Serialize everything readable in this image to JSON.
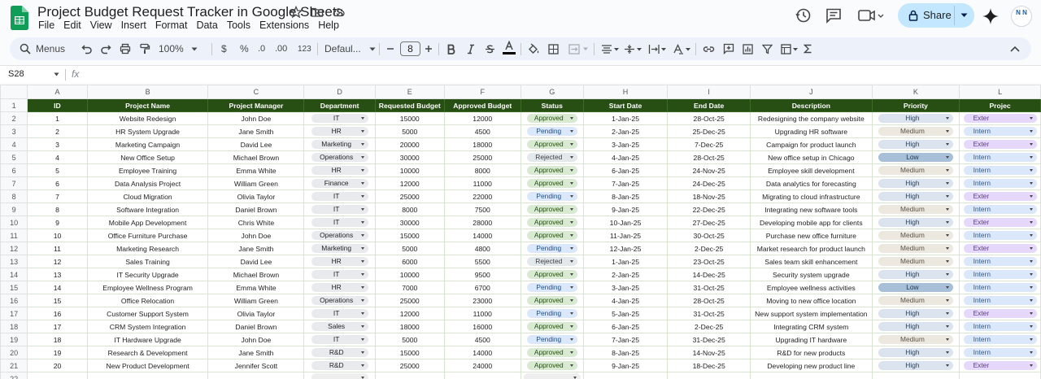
{
  "title_bar": {
    "doc_title": "Project Budget Request Tracker in Google Sheets",
    "menu": [
      "File",
      "Edit",
      "View",
      "Insert",
      "Format",
      "Data",
      "Tools",
      "Extensions",
      "Help"
    ],
    "share_label": "Share",
    "avatar_text": "N N"
  },
  "toolbar": {
    "menus_label": "Menus",
    "zoom": "100%",
    "currency": "$",
    "percent": "%",
    "dec_decrease": ".0",
    "dec_increase": ".00",
    "number_format": "123",
    "font": "Defaul...",
    "font_size": "8"
  },
  "formula_bar": {
    "cell_ref": "S28",
    "fx": "fx",
    "content": ""
  },
  "sheet": {
    "columns": [
      "A",
      "B",
      "C",
      "D",
      "E",
      "F",
      "G",
      "H",
      "I",
      "J",
      "K",
      "L"
    ],
    "headers": [
      "ID",
      "Project Name",
      "Project Manager",
      "Department",
      "Requested Budget",
      "Approved Budget",
      "Status",
      "Start Date",
      "End Date",
      "Description",
      "Priority",
      "Projec"
    ],
    "rows": [
      [
        "1",
        "Website Redesign",
        "John Doe",
        "IT",
        "15000",
        "12000",
        "Approved",
        "1-Jan-25",
        "28-Oct-25",
        "Redesigning the company website",
        "High",
        "Exter"
      ],
      [
        "2",
        "HR System Upgrade",
        "Jane Smith",
        "HR",
        "5000",
        "4500",
        "Pending",
        "2-Jan-25",
        "25-Dec-25",
        "Upgrading HR software",
        "Medium",
        "Intern"
      ],
      [
        "3",
        "Marketing Campaign",
        "David Lee",
        "Marketing",
        "20000",
        "18000",
        "Approved",
        "3-Jan-25",
        "7-Dec-25",
        "Campaign for product launch",
        "High",
        "Exter"
      ],
      [
        "4",
        "New Office Setup",
        "Michael Brown",
        "Operations",
        "30000",
        "25000",
        "Rejected",
        "4-Jan-25",
        "28-Oct-25",
        "New office setup in Chicago",
        "Low",
        "Intern"
      ],
      [
        "5",
        "Employee Training",
        "Emma White",
        "HR",
        "10000",
        "8000",
        "Approved",
        "6-Jan-25",
        "24-Nov-25",
        "Employee skill development",
        "Medium",
        "Intern"
      ],
      [
        "6",
        "Data Analysis Project",
        "William Green",
        "Finance",
        "12000",
        "11000",
        "Approved",
        "7-Jan-25",
        "24-Dec-25",
        "Data analytics for forecasting",
        "High",
        "Intern"
      ],
      [
        "7",
        "Cloud Migration",
        "Olivia Taylor",
        "IT",
        "25000",
        "22000",
        "Pending",
        "8-Jan-25",
        "18-Nov-25",
        "Migrating to cloud infrastructure",
        "High",
        "Exter"
      ],
      [
        "8",
        "Software Integration",
        "Daniel Brown",
        "IT",
        "8000",
        "7500",
        "Approved",
        "9-Jan-25",
        "22-Dec-25",
        "Integrating new software tools",
        "Medium",
        "Intern"
      ],
      [
        "9",
        "Mobile App Development",
        "Chris White",
        "IT",
        "30000",
        "28000",
        "Approved",
        "10-Jan-25",
        "27-Dec-25",
        "Developing mobile app for clients",
        "High",
        "Exter"
      ],
      [
        "10",
        "Office Furniture Purchase",
        "John Doe",
        "Operations",
        "15000",
        "14000",
        "Approved",
        "11-Jan-25",
        "30-Oct-25",
        "Purchase new office furniture",
        "Medium",
        "Intern"
      ],
      [
        "11",
        "Marketing Research",
        "Jane Smith",
        "Marketing",
        "5000",
        "4800",
        "Pending",
        "12-Jan-25",
        "2-Dec-25",
        "Market research for product launch",
        "Medium",
        "Exter"
      ],
      [
        "12",
        "Sales Training",
        "David Lee",
        "HR",
        "6000",
        "5500",
        "Rejected",
        "1-Jan-25",
        "23-Oct-25",
        "Sales team skill enhancement",
        "Medium",
        "Intern"
      ],
      [
        "13",
        "IT Security Upgrade",
        "Michael Brown",
        "IT",
        "10000",
        "9500",
        "Approved",
        "2-Jan-25",
        "14-Dec-25",
        "Security system upgrade",
        "High",
        "Intern"
      ],
      [
        "14",
        "Employee Wellness Program",
        "Emma White",
        "HR",
        "7000",
        "6700",
        "Pending",
        "3-Jan-25",
        "31-Oct-25",
        "Employee wellness activities",
        "Low",
        "Intern"
      ],
      [
        "15",
        "Office Relocation",
        "William Green",
        "Operations",
        "25000",
        "23000",
        "Approved",
        "4-Jan-25",
        "28-Oct-25",
        "Moving to new office location",
        "Medium",
        "Intern"
      ],
      [
        "16",
        "Customer Support System",
        "Olivia Taylor",
        "IT",
        "12000",
        "11000",
        "Pending",
        "5-Jan-25",
        "31-Oct-25",
        "New support system implementation",
        "High",
        "Exter"
      ],
      [
        "17",
        "CRM System Integration",
        "Daniel Brown",
        "Sales",
        "18000",
        "16000",
        "Approved",
        "6-Jan-25",
        "2-Dec-25",
        "Integrating CRM system",
        "High",
        "Intern"
      ],
      [
        "18",
        "IT Hardware Upgrade",
        "John Doe",
        "IT",
        "5000",
        "4500",
        "Pending",
        "7-Jan-25",
        "31-Dec-25",
        "Upgrading IT hardware",
        "Medium",
        "Intern"
      ],
      [
        "19",
        "Research & Development",
        "Jane Smith",
        "R&D",
        "15000",
        "14000",
        "Approved",
        "8-Jan-25",
        "14-Nov-25",
        "R&D for new products",
        "High",
        "Intern"
      ],
      [
        "20",
        "New Product Development",
        "Jennifer Scott",
        "R&D",
        "25000",
        "24000",
        "Approved",
        "9-Jan-25",
        "18-Dec-25",
        "Developing new product line",
        "High",
        "Exter"
      ]
    ],
    "row_numbers": [
      "1",
      "2",
      "3",
      "4",
      "5",
      "6",
      "7",
      "8",
      "9",
      "10",
      "11",
      "12",
      "13",
      "14",
      "15",
      "16",
      "17",
      "18",
      "19",
      "20",
      "21",
      "22"
    ]
  },
  "colors": {
    "header_bg": "#274e13",
    "share_bg": "#c2e7ff",
    "approved": "#d9ead3",
    "pending": "#dbe8fb",
    "external": "#e6d8fb"
  }
}
